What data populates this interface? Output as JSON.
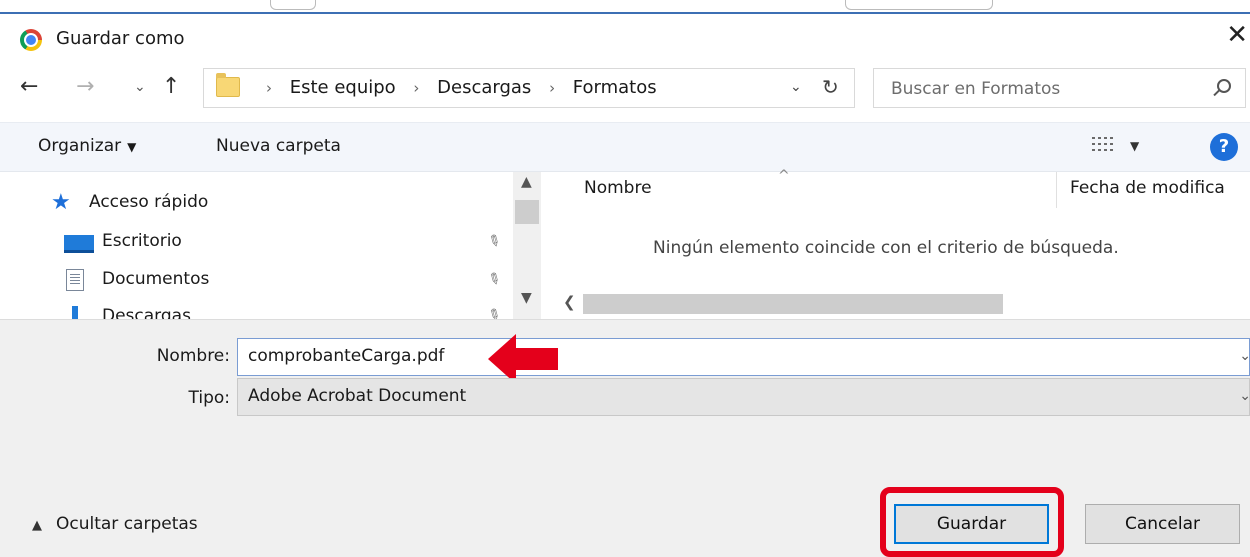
{
  "window": {
    "title": "Guardar como",
    "close_glyph": "✕"
  },
  "nav": {
    "back_glyph": "←",
    "forward_glyph": "→",
    "recent_glyph": "⌄",
    "up_glyph": "↑",
    "breadcrumbs": [
      "Este equipo",
      "Descargas",
      "Formatos"
    ],
    "breadcrumb_sep": "›",
    "dropdown_glyph": "⌄",
    "refresh_glyph": "↻"
  },
  "search": {
    "placeholder": "Buscar en Formatos"
  },
  "toolbar": {
    "organize_label": "Organizar",
    "organize_caret": "▼",
    "new_folder_label": "Nueva carpeta",
    "view_caret": "▼",
    "help_glyph": "?"
  },
  "sidebar": {
    "items": [
      {
        "label": "Acceso rápido",
        "icon": "star-icon"
      },
      {
        "label": "Escritorio",
        "icon": "desktop-icon",
        "pinned": true
      },
      {
        "label": "Documentos",
        "icon": "documents-icon",
        "pinned": true
      },
      {
        "label": "Descargas",
        "icon": "downloads-icon",
        "pinned": true
      }
    ],
    "pin_glyph": "📌"
  },
  "file_list": {
    "columns": [
      "Nombre",
      "Fecha de modifica"
    ],
    "sort_glyph": "^",
    "empty_message": "Ningún elemento coincide con el criterio de búsqueda."
  },
  "form": {
    "name_label": "Nombre:",
    "name_value": "comprobanteCarga.pdf",
    "type_label": "Tipo:",
    "type_value": "Adobe Acrobat Document"
  },
  "footer": {
    "hide_folders_label": "Ocultar carpetas",
    "save_label": "Guardar",
    "cancel_label": "Cancelar"
  },
  "colors": {
    "highlight": "#e4001b",
    "accent": "#0078d7",
    "help": "#1e6fd9"
  }
}
